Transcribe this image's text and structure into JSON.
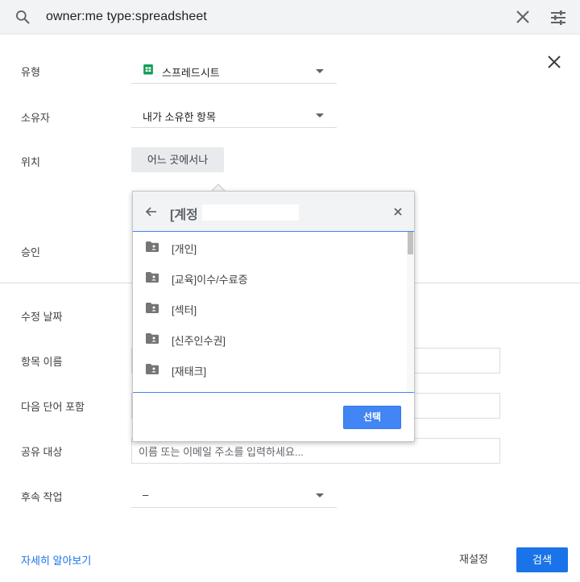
{
  "search": {
    "query": "owner:me type:spreadsheet"
  },
  "form": {
    "type": {
      "label": "유형",
      "value": "스프레드시트"
    },
    "owner": {
      "label": "소유자",
      "value": "내가 소유한 항목"
    },
    "location": {
      "label": "위치",
      "button": "어느 곳에서나"
    },
    "approval": {
      "label": "승인"
    },
    "modified": {
      "label": "수정 날짜"
    },
    "item_name": {
      "label": "항목 이름",
      "value": ""
    },
    "has_words": {
      "label": "다음 단어 포함",
      "value": ""
    },
    "shared_with": {
      "label": "공유 대상",
      "placeholder": "이름 또는 이메일 주소를 입력하세요..."
    },
    "follow_up": {
      "label": "후속 작업",
      "value": "–"
    }
  },
  "footer": {
    "learn_more": "자세히 알아보기",
    "reset": "재설정",
    "search": "검색"
  },
  "folder_picker": {
    "title": "[계정",
    "folders": [
      {
        "label": "[개인]"
      },
      {
        "label": "[교육]이수/수료증"
      },
      {
        "label": "[섹터]"
      },
      {
        "label": "[신주인수권]"
      },
      {
        "label": "[재태크]"
      }
    ],
    "select_label": "선택"
  },
  "colors": {
    "accent": "#1a73e8",
    "picker_accent": "#4285f4",
    "sheets_green": "#0f9d58"
  }
}
